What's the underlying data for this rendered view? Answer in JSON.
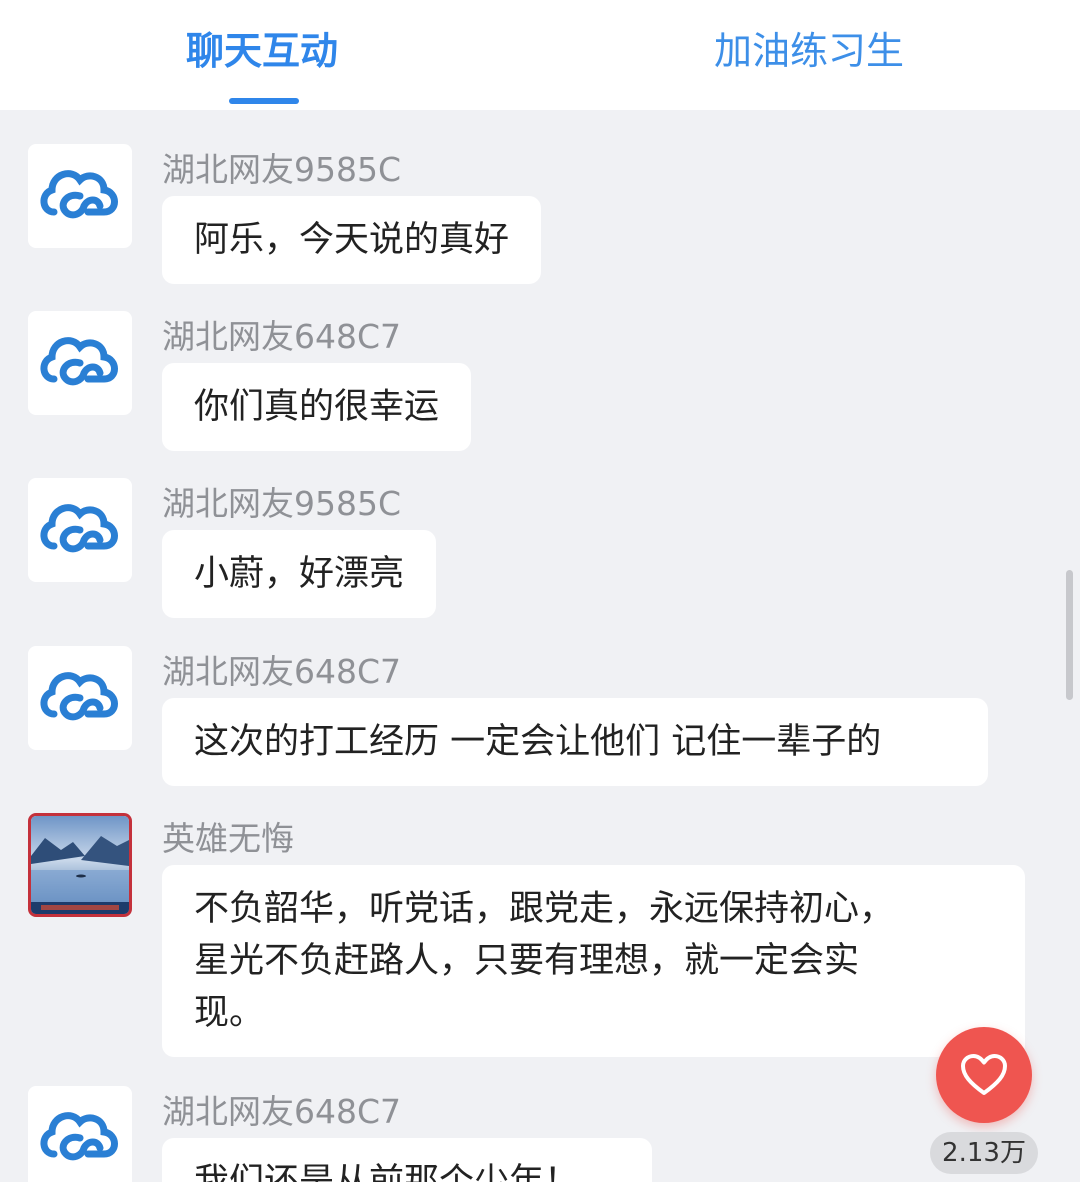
{
  "tabs": [
    {
      "label": "聊天互动",
      "active": true
    },
    {
      "label": "加油练习生",
      "active": false
    }
  ],
  "messages": [
    {
      "user": "湖北网友9585C",
      "avatar": "cloud-logo-icon",
      "lines": [
        "阿乐，今天说的真好"
      ]
    },
    {
      "user": "湖北网友648C7",
      "avatar": "cloud-logo-icon",
      "lines": [
        "你们真的很幸运"
      ]
    },
    {
      "user": "湖北网友9585C",
      "avatar": "cloud-logo-icon",
      "lines": [
        "小蔚，好漂亮"
      ]
    },
    {
      "user": "湖北网友648C7",
      "avatar": "cloud-logo-icon",
      "lines": [
        "这次的打工经历 一定会让他们 记住一辈子的"
      ]
    },
    {
      "user": "英雄无悔",
      "avatar": "landscape-photo",
      "lines": [
        "不负韶华，听党话，跟党走，永远保持初心，",
        "星光不负赶路人，只要有理想，就一定会实",
        "现。"
      ]
    },
    {
      "user": "湖北网友648C7",
      "avatar": "cloud-logo-icon",
      "lines": [
        "我们还是从前那个少年！"
      ]
    }
  ],
  "like": {
    "icon": "heart-icon",
    "count": "2.13万"
  },
  "colors": {
    "accent": "#2f86ea",
    "like": "#ef5550",
    "background": "#f0f1f4"
  }
}
